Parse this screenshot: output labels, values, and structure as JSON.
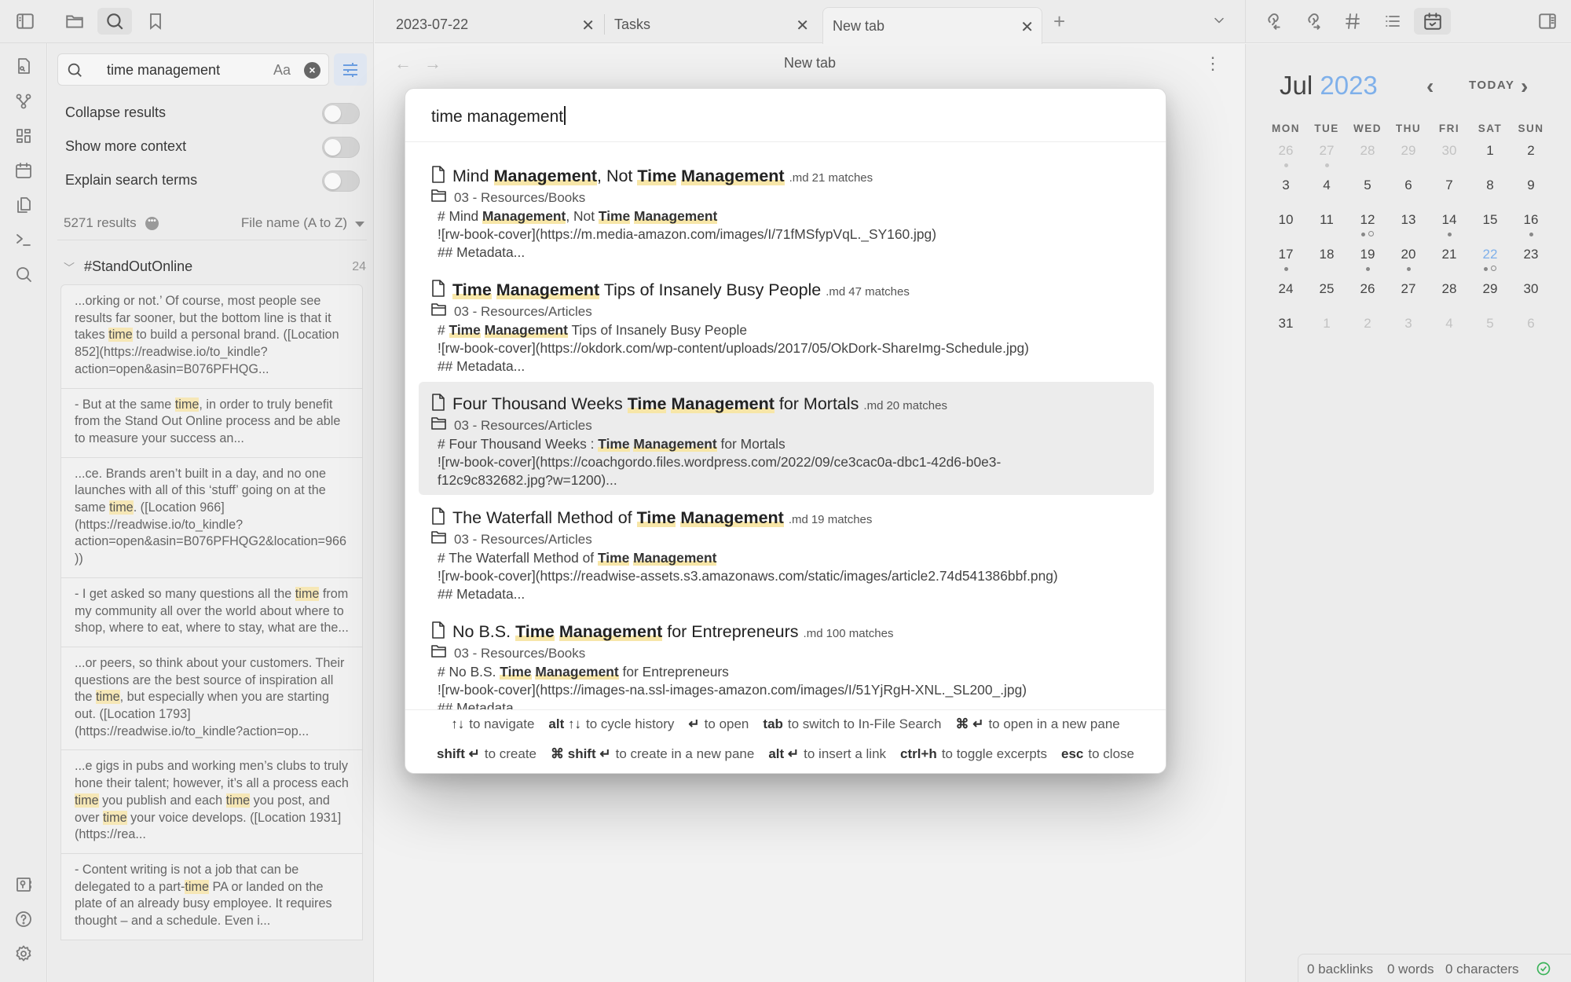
{
  "left_header": {
    "icons": [
      "sidebar-toggle-icon",
      "folder-icon",
      "search-icon",
      "bookmark-icon"
    ]
  },
  "ribbon": {
    "icons": [
      "file-search-icon",
      "graph-icon",
      "dashboard-icon",
      "calendar-icon",
      "copy-icon",
      "terminal-icon",
      "search-icon"
    ],
    "bottom_icons": [
      "vault-icon",
      "help-icon",
      "settings-icon"
    ]
  },
  "search_panel": {
    "query": "time management",
    "match_case_label": "Aa",
    "options": [
      {
        "label": "Collapse results",
        "on": false
      },
      {
        "label": "Show more context",
        "on": false
      },
      {
        "label": "Explain search terms",
        "on": false
      }
    ],
    "results_count": "5271 results",
    "sort": "File name (A to Z)",
    "group": {
      "name": "#StandOutOnline",
      "count": "24"
    },
    "snippets": [
      {
        "before": "...orking or not.’ Of course, most people see results far sooner, but the bottom line is that it takes ",
        "match": "time",
        "after": " to build a personal brand. ([Location 852](https://readwise.io/to_kindle?action=open&asin=B076PFHQG..."
      },
      {
        "before": "- But at the same ",
        "match": "time",
        "after": ", in order to truly benefit from the Stand Out Online process and be able to measure your success an..."
      },
      {
        "before": "...ce. Brands aren’t built in a day, and no one launches with all of this ‘stuff’ going on at the same ",
        "match": "time",
        "after": ". ([Location 966](https://readwise.io/to_kindle?action=open&asin=B076PFHQG2&location=966))"
      },
      {
        "before": "- I get asked so many questions all the ",
        "match": "time",
        "after": " from my community all over the world about where to shop, where to eat, where to stay, what are the..."
      },
      {
        "before": "...or peers, so think about your customers. Their questions are the best source of inspiration all the ",
        "match": "time",
        "after": ", but especially when you are starting out. ([Location 1793](https://readwise.io/to_kindle?action=op..."
      },
      {
        "before": "...e gigs in pubs and working men’s clubs to truly hone their talent; however, it’s all a process each ",
        "match": "time",
        "after": " you publish and each ",
        "match2": "time",
        "after2": " you post, and over ",
        "match3": "time",
        "after3": " your voice develops. ([Location 1931](https://rea..."
      },
      {
        "before": "- Content writing is not a job that can be delegated to a part-",
        "match": "time",
        "after": " PA or landed on the plate of an already busy employee. It requires thought – and a schedule. Even i..."
      }
    ]
  },
  "tabs": [
    {
      "label": "2023-07-22",
      "active": false
    },
    {
      "label": "Tasks",
      "active": false
    },
    {
      "label": "New tab",
      "active": true
    }
  ],
  "main": {
    "title": "New tab"
  },
  "switcher": {
    "query": "time management",
    "results": [
      {
        "title": [
          {
            "t": "Mind "
          },
          {
            "t": "Management",
            "h": true
          },
          {
            "t": ", Not "
          },
          {
            "t": "Time",
            "h": true
          },
          {
            "t": " "
          },
          {
            "t": "Management",
            "h": true
          }
        ],
        "ext": ".md",
        "matches": "21 matches",
        "path": "03 - Resources/Books",
        "excerpt": [
          {
            "t": "# Mind "
          },
          {
            "t": "Management",
            "h": true
          },
          {
            "t": ", Not "
          },
          {
            "t": "Time",
            "h": true
          },
          {
            "t": " "
          },
          {
            "t": "Management",
            "h": true
          },
          {
            "t": "\n![rw-book-cover](https://m.media-amazon.com/images/I/71fMSfypVqL._SY160.jpg)\n## Metadata..."
          }
        ],
        "selected": false
      },
      {
        "title": [
          {
            "t": "Time",
            "h": true
          },
          {
            "t": " "
          },
          {
            "t": "Management",
            "h": true
          },
          {
            "t": " Tips of Insanely Busy People"
          }
        ],
        "ext": ".md",
        "matches": "47 matches",
        "path": "03 - Resources/Articles",
        "excerpt": [
          {
            "t": "# "
          },
          {
            "t": "Time",
            "h": true
          },
          {
            "t": " "
          },
          {
            "t": "Management",
            "h": true
          },
          {
            "t": " Tips of Insanely Busy People\n![rw-book-cover](https://okdork.com/wp-content/uploads/2017/05/OkDork-ShareImg-Schedule.jpg)\n## Metadata..."
          }
        ],
        "selected": false
      },
      {
        "title": [
          {
            "t": "Four Thousand Weeks  "
          },
          {
            "t": "Time",
            "h": true
          },
          {
            "t": " "
          },
          {
            "t": "Management",
            "h": true
          },
          {
            "t": " for Mortals"
          }
        ],
        "ext": ".md",
        "matches": "20 matches",
        "path": "03 - Resources/Articles",
        "excerpt": [
          {
            "t": "# Four Thousand Weeks : "
          },
          {
            "t": "Time",
            "h": true
          },
          {
            "t": " "
          },
          {
            "t": "Management",
            "h": true
          },
          {
            "t": " for Mortals\n![rw-book-cover](https://coachgordo.files.wordpress.com/2022/09/ce3cac0a-dbc1-42d6-b0e3-\nf12c9c832682.jpg?w=1200)..."
          }
        ],
        "selected": true
      },
      {
        "title": [
          {
            "t": "The Waterfall Method of "
          },
          {
            "t": "Time",
            "h": true
          },
          {
            "t": " "
          },
          {
            "t": "Management",
            "h": true
          }
        ],
        "ext": ".md",
        "matches": "19 matches",
        "path": "03 - Resources/Articles",
        "excerpt": [
          {
            "t": "# The Waterfall Method of "
          },
          {
            "t": "Time",
            "h": true
          },
          {
            "t": " "
          },
          {
            "t": "Management",
            "h": true
          },
          {
            "t": "\n![rw-book-cover](https://readwise-assets.s3.amazonaws.com/static/images/article2.74d541386bbf.png)\n## Metadata..."
          }
        ],
        "selected": false
      },
      {
        "title": [
          {
            "t": "No B.S. "
          },
          {
            "t": "Time",
            "h": true
          },
          {
            "t": " "
          },
          {
            "t": "Management",
            "h": true
          },
          {
            "t": " for Entrepreneurs"
          }
        ],
        "ext": ".md",
        "matches": "100 matches",
        "path": "03 - Resources/Books",
        "excerpt": [
          {
            "t": "# No B.S. "
          },
          {
            "t": "Time",
            "h": true
          },
          {
            "t": " "
          },
          {
            "t": "Management",
            "h": true
          },
          {
            "t": " for Entrepreneurs\n![rw-book-cover](https://images-na.ssl-images-amazon.com/images/I/51YjRgH-XNL._SL200_.jpg)\n## Metadata..."
          }
        ],
        "selected": false
      }
    ],
    "hints_row1": [
      {
        "key": "↑↓",
        "text": "to navigate"
      },
      {
        "key": "alt ↑↓",
        "text": "to cycle history"
      },
      {
        "key": "↵",
        "text": "to open"
      },
      {
        "key": "tab",
        "text": "to switch to In-File Search"
      },
      {
        "key": "⌘ ↵",
        "text": "to open in a new pane"
      }
    ],
    "hints_row2": [
      {
        "key": "shift ↵",
        "text": "to create"
      },
      {
        "key": "⌘ shift ↵",
        "text": "to create in a new pane"
      },
      {
        "key": "alt ↵",
        "text": "to insert a link"
      },
      {
        "key": "ctrl+h",
        "text": "to toggle excerpts"
      },
      {
        "key": "esc",
        "text": "to close"
      }
    ]
  },
  "right_header": {
    "icons": [
      "backlinks-icon",
      "outgoing-links-icon",
      "tags-icon",
      "outline-icon",
      "calendar-check-icon",
      "right-sidebar-toggle-icon"
    ]
  },
  "calendar": {
    "month": "Jul",
    "year": "2023",
    "today_label": "TODAY",
    "weekdays": [
      "MON",
      "TUE",
      "WED",
      "THU",
      "FRI",
      "SAT",
      "SUN"
    ],
    "weeks": [
      [
        {
          "d": "26",
          "o": true,
          "dots": "f"
        },
        {
          "d": "27",
          "o": true,
          "dots": "f"
        },
        {
          "d": "28",
          "o": true
        },
        {
          "d": "29",
          "o": true
        },
        {
          "d": "30",
          "o": true
        },
        {
          "d": "1"
        },
        {
          "d": "2"
        }
      ],
      [
        {
          "d": "3"
        },
        {
          "d": "4"
        },
        {
          "d": "5"
        },
        {
          "d": "6"
        },
        {
          "d": "7"
        },
        {
          "d": "8"
        },
        {
          "d": "9"
        }
      ],
      [
        {
          "d": "10"
        },
        {
          "d": "11"
        },
        {
          "d": "12",
          "dots": "so"
        },
        {
          "d": "13"
        },
        {
          "d": "14",
          "dots": "s"
        },
        {
          "d": "15"
        },
        {
          "d": "16",
          "dots": "s"
        }
      ],
      [
        {
          "d": "17",
          "dots": "s"
        },
        {
          "d": "18"
        },
        {
          "d": "19",
          "dots": "s"
        },
        {
          "d": "20",
          "dots": "s"
        },
        {
          "d": "21"
        },
        {
          "d": "22",
          "today": true,
          "dots": "so"
        },
        {
          "d": "23"
        }
      ],
      [
        {
          "d": "24"
        },
        {
          "d": "25"
        },
        {
          "d": "26"
        },
        {
          "d": "27"
        },
        {
          "d": "28"
        },
        {
          "d": "29"
        },
        {
          "d": "30"
        }
      ],
      [
        {
          "d": "31"
        },
        {
          "d": "1",
          "o": true
        },
        {
          "d": "2",
          "o": true
        },
        {
          "d": "3",
          "o": true
        },
        {
          "d": "4",
          "o": true
        },
        {
          "d": "5",
          "o": true
        },
        {
          "d": "6",
          "o": true
        }
      ]
    ]
  },
  "status": {
    "backlinks": "0 backlinks",
    "words": "0 words",
    "characters": "0 characters",
    "sync_color": "#3cb35a"
  }
}
